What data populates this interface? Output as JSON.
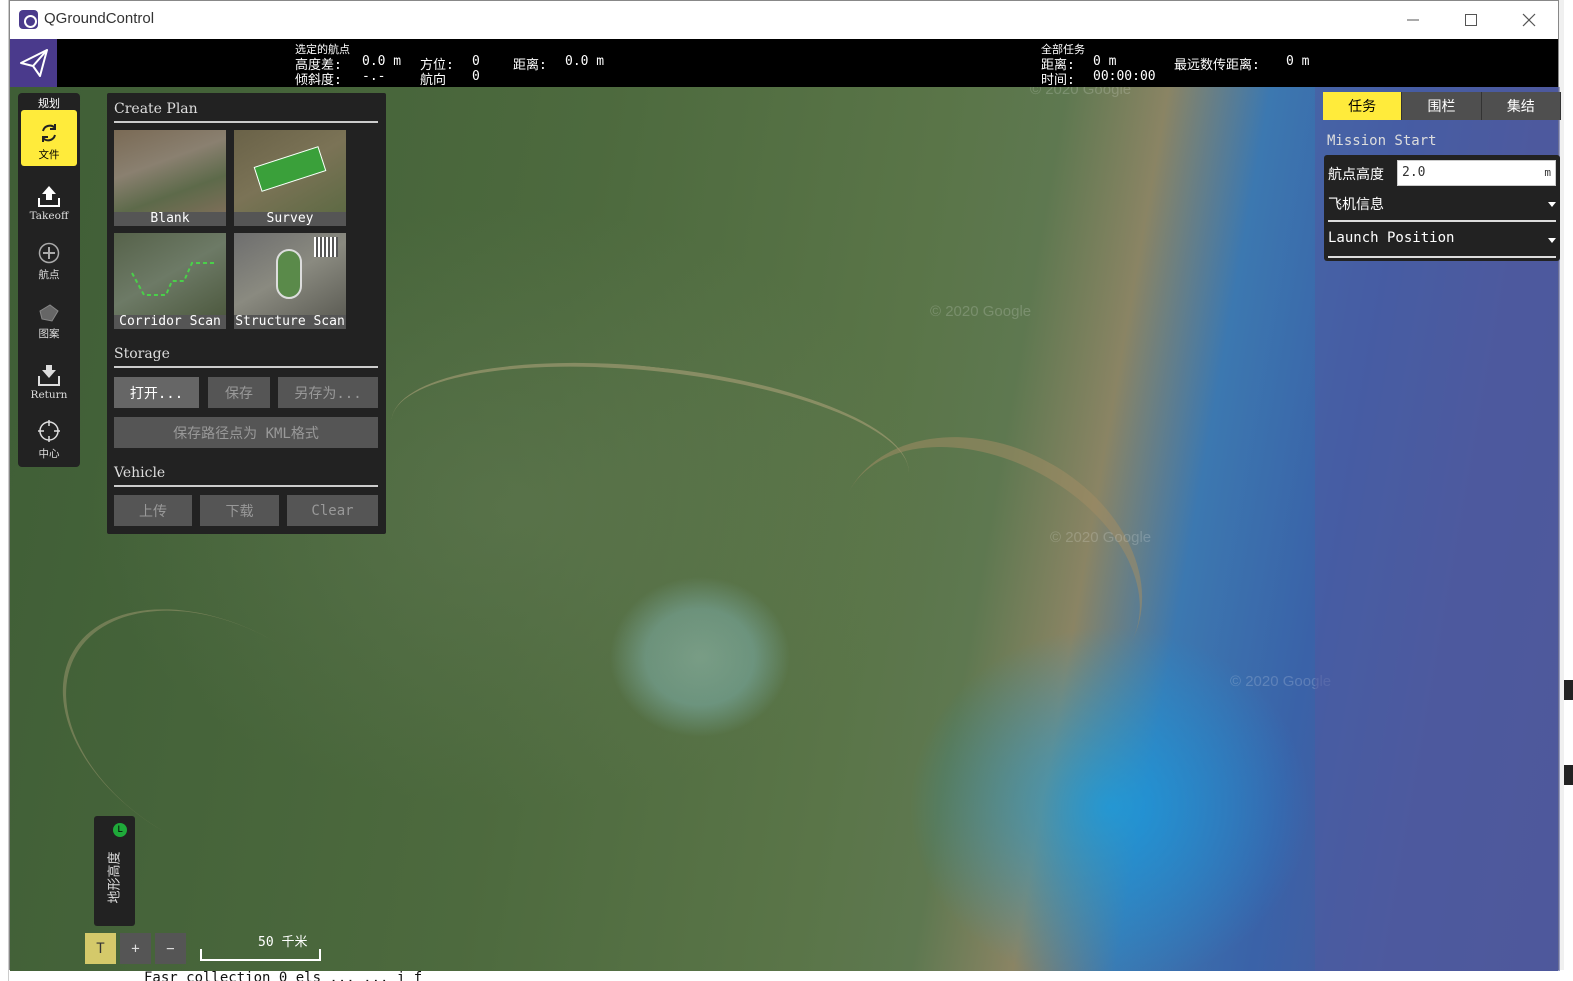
{
  "app": {
    "title": "QGroundControl"
  },
  "window_controls": {
    "minimize": "—",
    "maximize": "☐",
    "close": "✕"
  },
  "toolbar": {
    "selected_wp_heading": "选定的航点",
    "alt_diff_label": "高度差:",
    "alt_diff_value": "0.0 m",
    "azimuth_label": "方位:",
    "azimuth_value": "0",
    "distance_label": "距离:",
    "distance_value": "0.0 m",
    "gradient_label": "倾斜度:",
    "gradient_value": "-.-",
    "heading_label": "航向",
    "heading_value": "0",
    "total_mission_heading": "全部任务",
    "total_distance_label": "距离:",
    "total_distance_value": "0 m",
    "max_telem_label": "最远数传距离:",
    "max_telem_value": "0 m",
    "time_label": "时间:",
    "time_value": "00:00:00"
  },
  "toolstrip": {
    "header": "规划",
    "items": [
      {
        "label": "文件",
        "icon": "sync-icon",
        "active": true
      },
      {
        "label": "Takeoff",
        "icon": "takeoff-icon",
        "active": false
      },
      {
        "label": "航点",
        "icon": "add-waypoint-icon",
        "active": false
      },
      {
        "label": "图案",
        "icon": "pattern-icon",
        "active": false
      },
      {
        "label": "Return",
        "icon": "return-icon",
        "active": false
      },
      {
        "label": "中心",
        "icon": "crosshair-icon",
        "active": false
      }
    ]
  },
  "plan_panel": {
    "create_plan_title": "Create Plan",
    "templates": [
      {
        "label": "Blank"
      },
      {
        "label": "Survey"
      },
      {
        "label": "Corridor Scan"
      },
      {
        "label": "Structure Scan"
      }
    ],
    "storage_title": "Storage",
    "open_label": "打开...",
    "save_label": "保存",
    "save_as_label": "另存为...",
    "save_kml_label": "保存路径点为 KML格式",
    "vehicle_title": "Vehicle",
    "upload_label": "上传",
    "download_label": "下载",
    "clear_label": "Clear"
  },
  "right_panel": {
    "tabs": [
      {
        "label": "任务",
        "active": true
      },
      {
        "label": "围栏",
        "active": false
      },
      {
        "label": "集结",
        "active": false
      }
    ],
    "mission_start_label": "Mission Start",
    "waypoint_alt_label": "航点高度",
    "waypoint_alt_value": "2.0",
    "waypoint_alt_unit": "m",
    "vehicle_info_label": "飞机信息",
    "launch_position_label": "Launch Position"
  },
  "map": {
    "watermarks": [
      "© 2020 Google",
      "© 2020 Google",
      "© 2020 Google",
      "© 2020 Google"
    ],
    "terrain_label": "地形高度",
    "terrain_indicator": "L",
    "terrain_toggle_label": "T",
    "zoom_in_label": "+",
    "zoom_out_label": "−",
    "scale_label": "50 千米"
  },
  "background_text": {
    "bottom_line": "Fasr collection 0 els ... ... i f"
  },
  "colors": {
    "accent": "#ffeb3b",
    "brand": "#4a3a8c",
    "panel": "#222222"
  }
}
